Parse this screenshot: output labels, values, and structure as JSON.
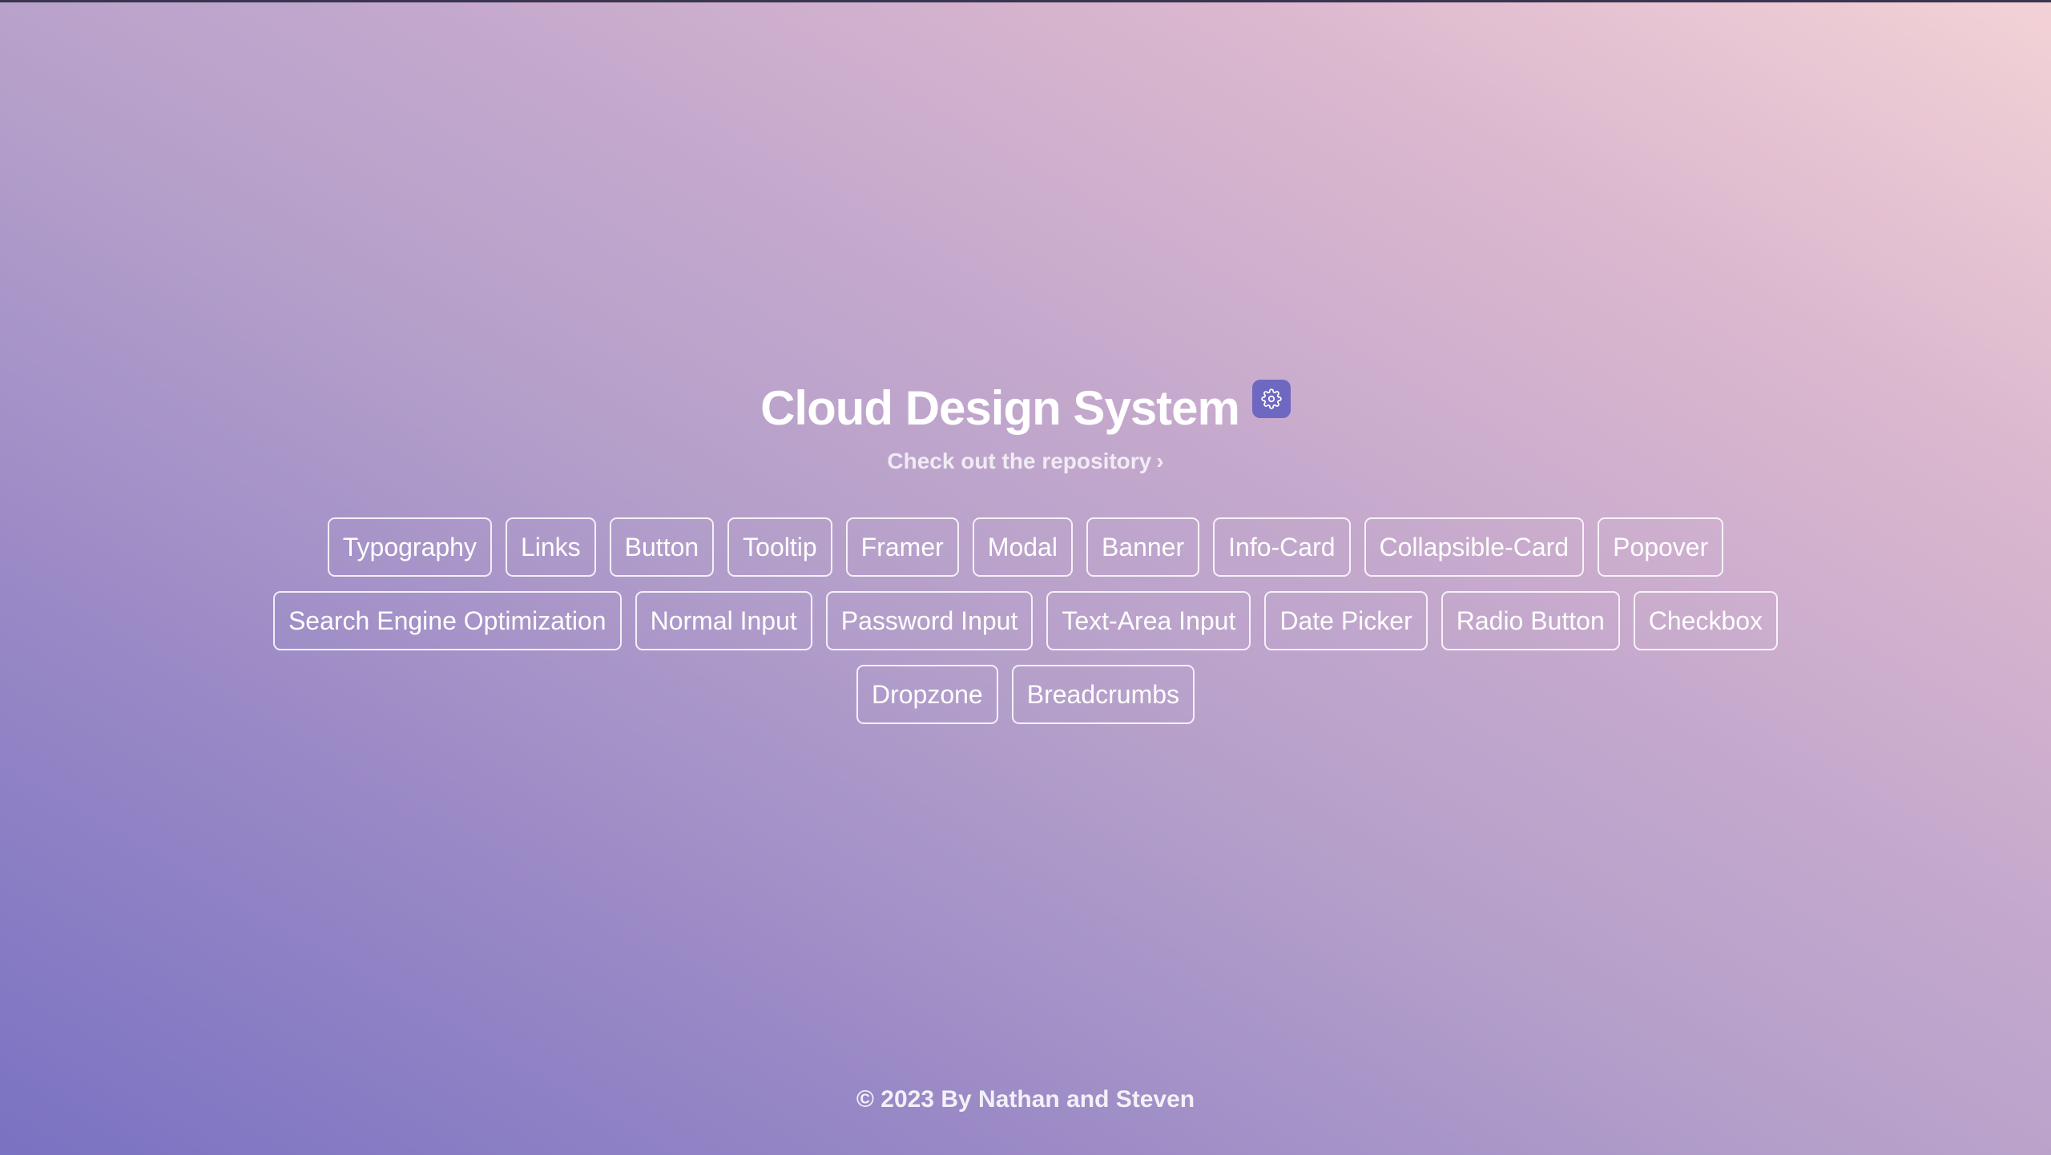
{
  "header": {
    "title": "Cloud Design System",
    "theme_icon": "gear-icon",
    "repo_link_label": "Check out the repository",
    "repo_link_chevron": "›"
  },
  "components": [
    "Typography",
    "Links",
    "Button",
    "Tooltip",
    "Framer",
    "Modal",
    "Banner",
    "Info-Card",
    "Collapsible-Card",
    "Popover",
    "Search Engine Optimization",
    "Normal Input",
    "Password Input",
    "Text-Area Input",
    "Date Picker",
    "Radio Button",
    "Checkbox",
    "Dropzone",
    "Breadcrumbs"
  ],
  "footer": {
    "text": "© 2023 By Nathan and Steven"
  },
  "colors": {
    "accent": "#6f68c0",
    "gradient_start": "#7a72c2",
    "gradient_end": "#f3d2d6"
  }
}
